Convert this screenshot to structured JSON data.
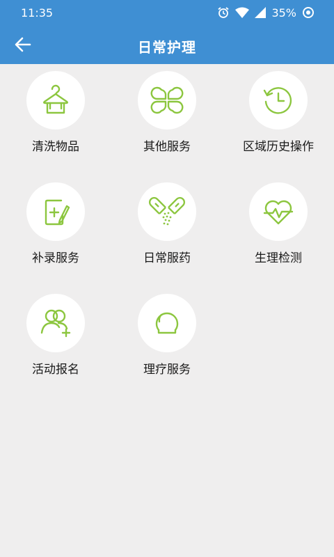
{
  "status": {
    "time": "11:35",
    "battery": "35%"
  },
  "header": {
    "title": "日常护理"
  },
  "items": [
    {
      "label": "清洗物品",
      "icon": "hanger-icon"
    },
    {
      "label": "其他服务",
      "icon": "clover-icon"
    },
    {
      "label": "区域历史操作",
      "icon": "history-clock-icon"
    },
    {
      "label": "补录服务",
      "icon": "add-record-icon"
    },
    {
      "label": "日常服药",
      "icon": "capsule-icon"
    },
    {
      "label": "生理检测",
      "icon": "heartbeat-icon"
    },
    {
      "label": "活动报名",
      "icon": "add-user-icon"
    },
    {
      "label": "理疗服务",
      "icon": "therapy-dome-icon"
    }
  ],
  "colors": {
    "primary": "#3f8fd3",
    "accent": "#8cc63f",
    "background": "#efeeee"
  }
}
